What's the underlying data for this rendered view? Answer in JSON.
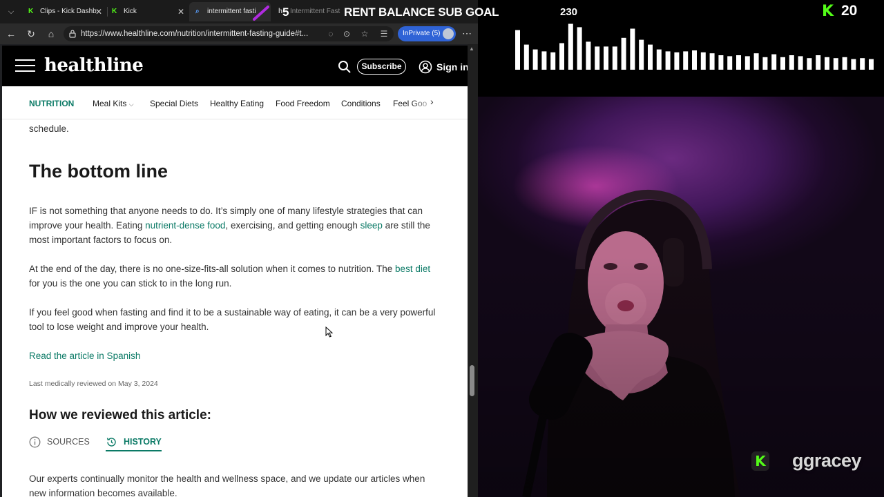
{
  "browser": {
    "tabs": [
      {
        "label": "Clips - Kick Dashb",
        "icon": "kick-icon"
      },
      {
        "label": "Kick",
        "icon": "kick-icon"
      },
      {
        "label": "intermittent fasti",
        "icon": "search-icon"
      },
      {
        "label": "Intermittent Fast",
        "icon": "healthline-icon"
      }
    ],
    "url": "https://www.healthline.com/nutrition/intermittent-fasting-guide#t...",
    "inprivate_label": "InPrivate (5)"
  },
  "site": {
    "logo": "healthline",
    "subscribe_label": "Subscribe",
    "signin_label": "Sign in",
    "nav": [
      "NUTRITION",
      "Meal Kits",
      "Special Diets",
      "Healthy Eating",
      "Food Freedom",
      "Conditions",
      "Feel Goo"
    ]
  },
  "article": {
    "prev_tail": "schedule.",
    "heading": "The bottom line",
    "p1": {
      "a": "IF is not something that anyone needs to do. It’s simply one of many lifestyle strategies that can improve your health. Eating ",
      "link1": "nutrient-dense food",
      "b": ", exercising, and getting enough ",
      "link2": "sleep",
      "c": " are still the most important factors to focus on."
    },
    "p2": {
      "a": "At the end of the day, there is no one-size-fits-all solution when it comes to nutrition. The ",
      "link": "best diet",
      "b": " for you is the one you can stick to in the long run."
    },
    "p3": "If you feel good when fasting and find it to be a sustainable way of eating, it can be a very powerful tool to lose weight and improve your health.",
    "spanish_link": "Read the article in Spanish",
    "reviewed": "Last medically reviewed on May 3, 2024",
    "how_heading": "How we reviewed this article:",
    "tab_sources": "SOURCES",
    "tab_history": "HISTORY",
    "p4": "Our experts continually monitor the health and wellness space, and we update our articles when new information becomes available."
  },
  "overlay": {
    "goal_current": "5",
    "goal_title": "RENT BALANCE SUB GOAL",
    "goal_target": "230",
    "kick_count": "20",
    "streamer": "ggracey",
    "brand_color": "#53fc18",
    "visualizer_levels": [
      0.82,
      0.52,
      0.42,
      0.38,
      0.36,
      0.55,
      0.95,
      0.88,
      0.58,
      0.48,
      0.48,
      0.48,
      0.66,
      0.85,
      0.62,
      0.52,
      0.42,
      0.38,
      0.36,
      0.38,
      0.4,
      0.36,
      0.34,
      0.3,
      0.28,
      0.3,
      0.28,
      0.34,
      0.26,
      0.32,
      0.26,
      0.3,
      0.28,
      0.24,
      0.3,
      0.26,
      0.24,
      0.26,
      0.22,
      0.24,
      0.22
    ]
  }
}
